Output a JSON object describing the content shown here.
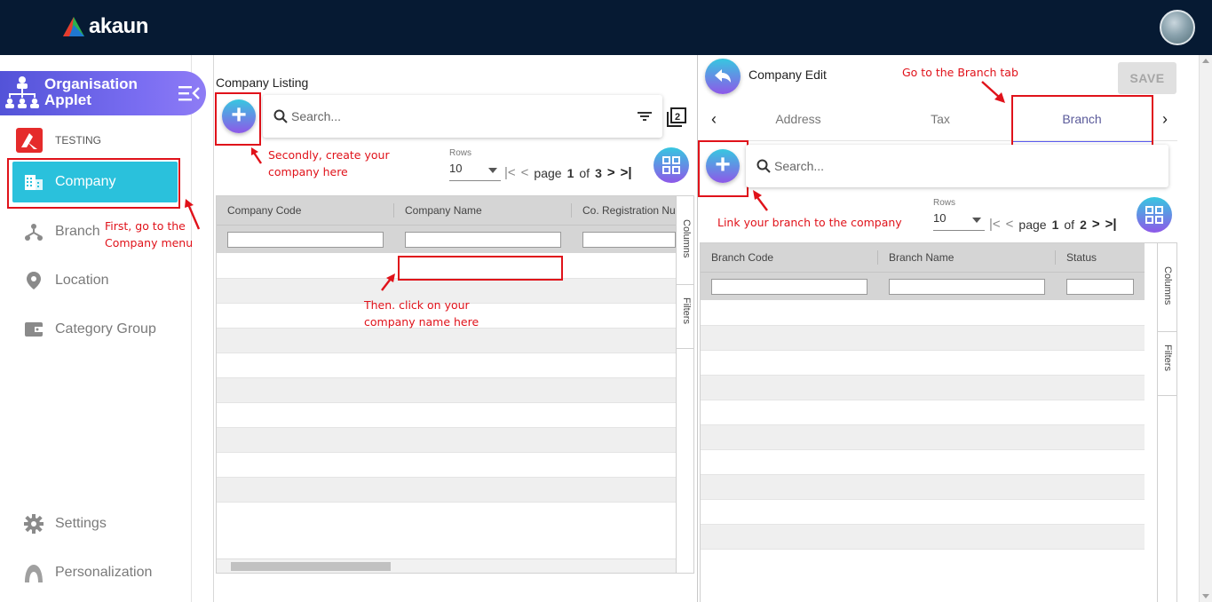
{
  "app": {
    "brand": "akaun"
  },
  "sidebar": {
    "applet_title": "Organisation Applet",
    "tenant": "TESTING",
    "items": [
      {
        "label": "Company",
        "icon": "building-icon",
        "active": true
      },
      {
        "label": "Branch",
        "icon": "branch-icon"
      },
      {
        "label": "Location",
        "icon": "location-pin-icon"
      },
      {
        "label": "Category Group",
        "icon": "wallet-icon"
      }
    ],
    "footer": [
      {
        "label": "Settings",
        "icon": "gear-icon"
      },
      {
        "label": "Personalization",
        "icon": "user-icon"
      }
    ]
  },
  "listing": {
    "title": "Company Listing",
    "search_placeholder": "Search...",
    "rows_label": "Rows",
    "rows_value": "10",
    "page_word": "page",
    "page_current": "1",
    "of_word": "of",
    "page_total": "3",
    "columns": [
      "Company Code",
      "Company Name",
      "Co. Registration Nu"
    ],
    "side_tabs": [
      "Columns",
      "Filters"
    ]
  },
  "edit": {
    "title": "Company Edit",
    "save_label": "SAVE",
    "tabs": [
      "Address",
      "Tax",
      "Branch"
    ],
    "active_tab": "Branch",
    "search_placeholder": "Search...",
    "rows_label": "Rows",
    "rows_value": "10",
    "page_word": "page",
    "page_current": "1",
    "of_word": "of",
    "page_total": "2",
    "columns": [
      "Branch Code",
      "Branch Name",
      "Status"
    ],
    "side_tabs": [
      "Columns",
      "Filters"
    ]
  },
  "annotations": {
    "first": "First, go to the Company menu",
    "first_l1": "First, go to the",
    "first_l2": "Company menu",
    "second_l1": "Secondly, create your",
    "second_l2": "company here",
    "third_l1": "Then. click on your",
    "third_l2": "company name here",
    "branch_tab": "Go to the Branch tab",
    "link_branch": "Link your branch to the company"
  },
  "colors": {
    "topbar": "#061a33",
    "active_nav": "#2ac1dc",
    "annotation": "#e0121a",
    "applet_header": "#6a5ee8"
  }
}
